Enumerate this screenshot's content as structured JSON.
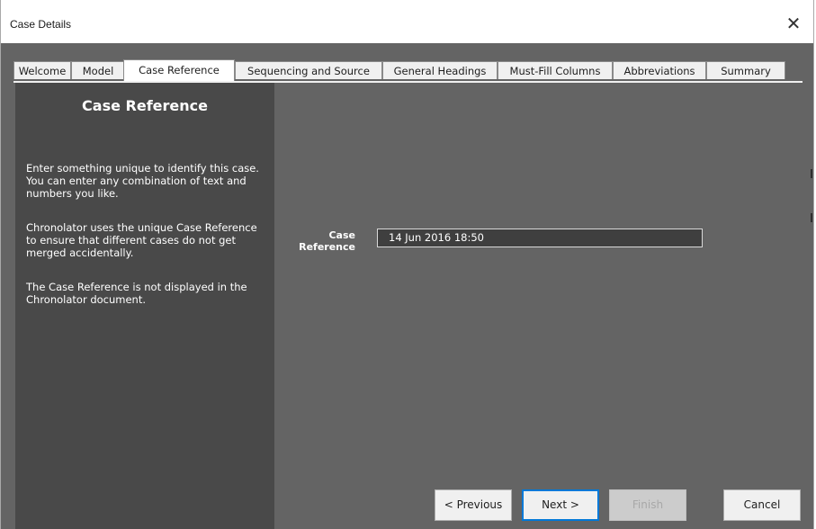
{
  "window": {
    "title": "Case Details",
    "close_glyph": "✕"
  },
  "tabs": [
    {
      "label": "Welcome"
    },
    {
      "label": "Model"
    },
    {
      "label": "Case Reference"
    },
    {
      "label": "Sequencing and Source"
    },
    {
      "label": "General Headings"
    },
    {
      "label": "Must-Fill Columns"
    },
    {
      "label": "Abbreviations"
    },
    {
      "label": "Summary"
    }
  ],
  "active_tab": "Case Reference",
  "sidebar": {
    "title": "Case Reference",
    "paragraphs": [
      "Enter something unique to identify this case. You can enter any combination of text and numbers you like.",
      "Chronolator uses the unique Case Reference to ensure that different cases do not get merged accidentally.",
      "The Case Reference is not displayed in the Chronolator document."
    ]
  },
  "form": {
    "label": "Case Reference",
    "value": "14 Jun 2016 18:50"
  },
  "buttons": {
    "previous": "< Previous",
    "next": "Next >",
    "finish": "Finish",
    "cancel": "Cancel"
  },
  "colors": {
    "panel_bg": "#646464",
    "sidebar_bg": "#494949",
    "input_bg": "#3f3f3f",
    "focus_accent": "#0078d7"
  }
}
